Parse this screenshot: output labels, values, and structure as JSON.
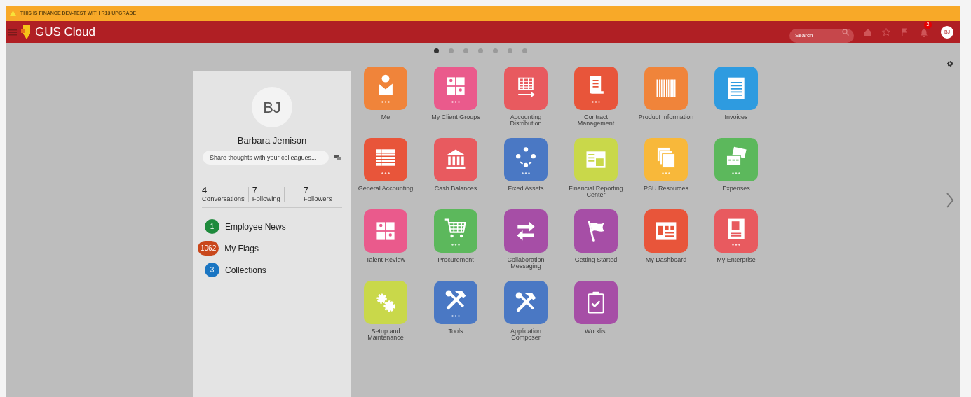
{
  "banner": {
    "text": "THIS IS FINANCE DEV-TEST WITH R13 UPGRADE"
  },
  "navbar": {
    "title": "GUS Cloud",
    "search": {
      "placeholder": "Search"
    },
    "notification_count": "2",
    "avatar": "BJ"
  },
  "page_dots": [
    {
      "selected": true
    },
    {
      "selected": false
    },
    {
      "selected": false
    },
    {
      "selected": false
    },
    {
      "selected": false
    },
    {
      "selected": false
    },
    {
      "selected": false
    }
  ],
  "profile": {
    "initials": "BJ",
    "name": "Barbara Jemison",
    "share": {
      "placeholder": "Share thoughts with your colleagues..."
    },
    "stats": [
      {
        "value": "4",
        "label": "Conversations"
      },
      {
        "value": "7",
        "label": "Following"
      },
      {
        "value": "7",
        "label": "Followers"
      }
    ],
    "links": [
      {
        "count": "1",
        "label": "Employee News",
        "color": "#1e8a3c"
      },
      {
        "count": "1062",
        "label": "My Flags",
        "color": "#c9471b"
      },
      {
        "count": "3",
        "label": "Collections",
        "color": "#1a75c2"
      }
    ]
  },
  "apps": [
    {
      "label": "Me",
      "color": "#f0843a",
      "more": true
    },
    {
      "label": "My Client Groups",
      "color": "#ea5a8c",
      "more": true
    },
    {
      "label": "Accounting Distribution",
      "color": "#e85a5f",
      "more": false
    },
    {
      "label": "Contract Management",
      "color": "#e8553a",
      "more": true
    },
    {
      "label": "Product Information",
      "color": "#f0843a",
      "more": false
    },
    {
      "label": "Invoices",
      "color": "#2e9be0",
      "more": false
    },
    {
      "label": "General Accounting",
      "color": "#e8553a",
      "more": true
    },
    {
      "label": "Cash Balances",
      "color": "#e85a5f",
      "more": false
    },
    {
      "label": "Fixed Assets",
      "color": "#4a78c4",
      "more": true
    },
    {
      "label": "Financial Reporting Center",
      "color": "#c9d84a",
      "more": false
    },
    {
      "label": "PSU Resources",
      "color": "#f8b83a",
      "more": true
    },
    {
      "label": "Expenses",
      "color": "#5cb85c",
      "more": true
    },
    {
      "label": "Talent Review",
      "color": "#ea5a8c",
      "more": false
    },
    {
      "label": "Procurement",
      "color": "#5cb85c",
      "more": true
    },
    {
      "label": "Collaboration Messaging",
      "color": "#a64ea6",
      "more": false
    },
    {
      "label": "Getting Started",
      "color": "#a64ea6",
      "more": false
    },
    {
      "label": "My Dashboard",
      "color": "#e8553a",
      "more": false
    },
    {
      "label": "My Enterprise",
      "color": "#e85a5f",
      "more": true
    },
    {
      "label": "Setup and Maintenance",
      "color": "#c9d84a",
      "more": false
    },
    {
      "label": "Tools",
      "color": "#4a78c4",
      "more": true
    },
    {
      "label": "Application Composer",
      "color": "#4a78c4",
      "more": false
    },
    {
      "label": "Worklist",
      "color": "#a64ea6",
      "more": false
    }
  ]
}
